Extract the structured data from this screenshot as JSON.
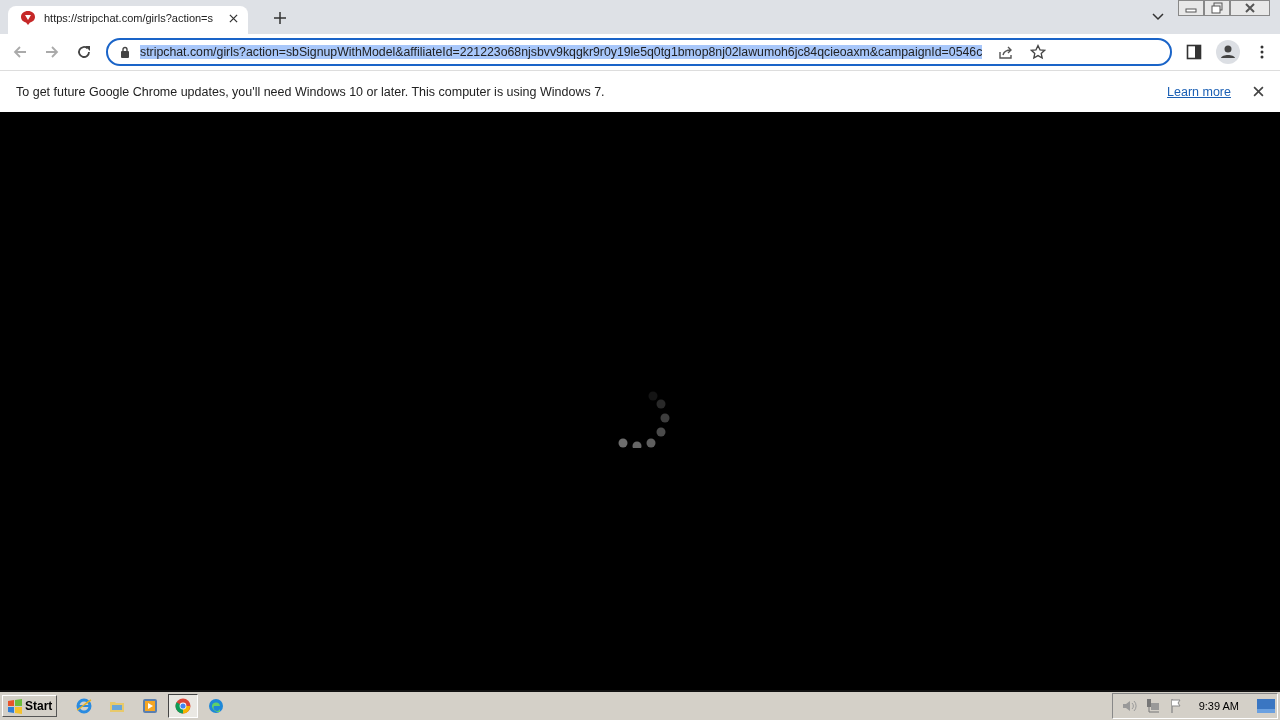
{
  "tab": {
    "title": "https://stripchat.com/girls?action=s",
    "selected": true
  },
  "address_bar": {
    "url": "stripchat.com/girls?action=sbSignupWithModel&affiliateId=221223o68njsbvv9kqgkr9r0y19le5q0tg1bmop8nj02lawumoh6jc84qcieoaxm&campaignId=0546c",
    "selected": true
  },
  "infobar": {
    "message": "To get future Google Chrome updates, you'll need Windows 10 or later. This computer is using Windows 7.",
    "link": "Learn more"
  },
  "taskbar": {
    "start": "Start",
    "apps": [
      {
        "kind": "ie",
        "selected": false
      },
      {
        "kind": "explorer",
        "selected": false
      },
      {
        "kind": "media",
        "selected": false
      },
      {
        "kind": "chrome",
        "selected": true
      },
      {
        "kind": "edge",
        "selected": false
      }
    ],
    "clock": "9:39 AM"
  }
}
